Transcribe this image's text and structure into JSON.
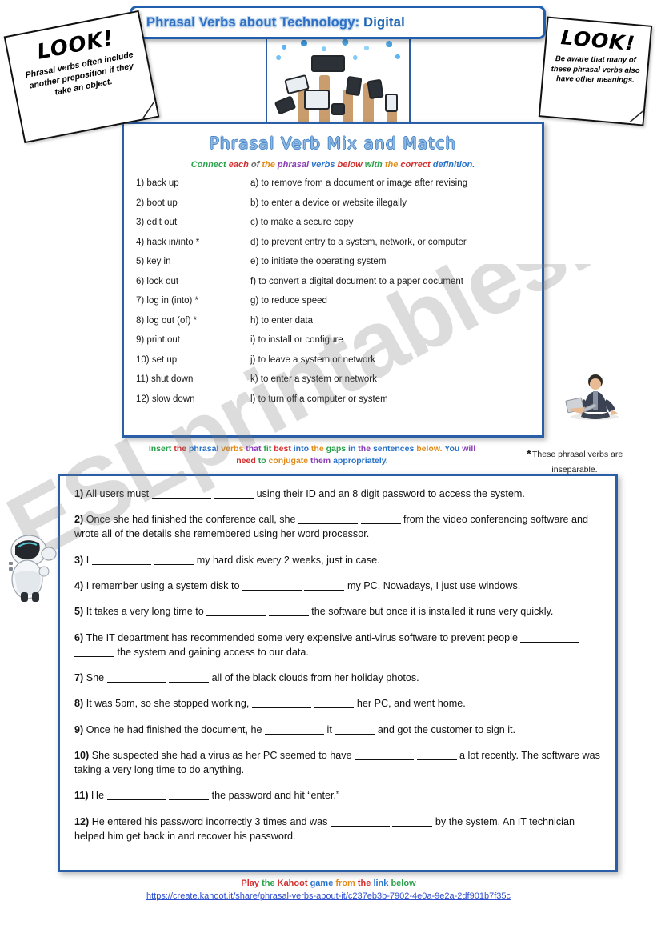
{
  "title": {
    "part1": "Phrasal Verbs about Technology:",
    "part2": " Digital"
  },
  "notes": {
    "left": {
      "heading": "LOOK!",
      "body": "Phrasal verbs often include another preposition if they take an object."
    },
    "right": {
      "heading": "LOOK!",
      "body": "Be aware that many of these phrasal verbs also have other meanings."
    }
  },
  "images": {
    "collage_alt": "technology-devices-collage",
    "man_alt": "man-sitting-with-laptop",
    "robot_alt": "white-robot-peeking"
  },
  "match_section": {
    "heading": "Phrasal Verb Mix and Match",
    "instruction_words": [
      {
        "text": "Connect ",
        "color": "#2aa14b"
      },
      {
        "text": "each ",
        "color": "#d32f2f"
      },
      {
        "text": "of ",
        "color": "#6d6d6d"
      },
      {
        "text": "the ",
        "color": "#e08c1a"
      },
      {
        "text": "phrasal ",
        "color": "#8a3fb5"
      },
      {
        "text": "verbs ",
        "color": "#2a72c9"
      },
      {
        "text": "below ",
        "color": "#d32f2f"
      },
      {
        "text": "with ",
        "color": "#2aa14b"
      },
      {
        "text": "the ",
        "color": "#e08c1a"
      },
      {
        "text": "correct ",
        "color": "#d32f2f"
      },
      {
        "text": "definition.",
        "color": "#2a72c9"
      }
    ],
    "rows": [
      {
        "verb": "1) back up",
        "definition": "a) to remove from a document or image after revising"
      },
      {
        "verb": "2) boot up",
        "definition": "b) to enter a device or website illegally"
      },
      {
        "verb": "3) edit out",
        "definition": "c) to make a secure copy"
      },
      {
        "verb": "4) hack in/into *",
        "definition": "d) to prevent entry to a system, network, or computer"
      },
      {
        "verb": "5) key in",
        "definition": "e) to initiate the operating system"
      },
      {
        "verb": "6) lock out",
        "definition": "f) to convert a digital document to a paper document"
      },
      {
        "verb": "7) log in (into) *",
        "definition": "g) to reduce speed"
      },
      {
        "verb": "8)  log out (of) *",
        "definition": "h) to enter data"
      },
      {
        "verb": "9)  print out",
        "definition": "i) to install or configure"
      },
      {
        "verb": "10) set up",
        "definition": "j) to leave a system or network"
      },
      {
        "verb": "11) shut down",
        "definition": "k) to enter a system  or network"
      },
      {
        "verb": "12) slow down",
        "definition": "l) to turn off a computer or system"
      }
    ]
  },
  "insert_instruction_words": [
    {
      "text": "Insert ",
      "color": "#2aa14b"
    },
    {
      "text": "the ",
      "color": "#d32f2f"
    },
    {
      "text": "phrasal ",
      "color": "#2a72c9"
    },
    {
      "text": "verbs ",
      "color": "#e08c1a"
    },
    {
      "text": "that ",
      "color": "#8a3fb5"
    },
    {
      "text": "fit ",
      "color": "#2aa14b"
    },
    {
      "text": "best ",
      "color": "#d32f2f"
    },
    {
      "text": "into ",
      "color": "#2a72c9"
    },
    {
      "text": "the ",
      "color": "#e08c1a"
    },
    {
      "text": "gaps ",
      "color": "#2aa14b"
    },
    {
      "text": "in ",
      "color": "#2a72c9"
    },
    {
      "text": "the ",
      "color": "#8a3fb5"
    },
    {
      "text": "sentences ",
      "color": "#2a72c9"
    },
    {
      "text": "below. ",
      "color": "#e08c1a"
    },
    {
      "text": "You ",
      "color": "#2a72c9"
    },
    {
      "text": "will ",
      "color": "#8a3fb5"
    },
    {
      "text": "need ",
      "color": "#d32f2f"
    },
    {
      "text": "to ",
      "color": "#2aa14b"
    },
    {
      "text": "conjugate ",
      "color": "#e08c1a"
    },
    {
      "text": "them ",
      "color": "#8a3fb5"
    },
    {
      "text": "appropriately.",
      "color": "#2a72c9"
    }
  ],
  "asterisk_note": "These phrasal verbs are inseparable.",
  "gapfill": [
    {
      "num": "1)",
      "parts": [
        {
          "t": "text",
          "v": " All users must "
        },
        {
          "t": "blank-long"
        },
        {
          "t": "text",
          "v": "  "
        },
        {
          "t": "blank-short"
        },
        {
          "t": "text",
          "v": " using their ID and an 8 digit password to access the system."
        }
      ]
    },
    {
      "num": "2)",
      "parts": [
        {
          "t": "text",
          "v": " Once she had finished the conference call, she "
        },
        {
          "t": "blank-long"
        },
        {
          "t": "text",
          "v": "  "
        },
        {
          "t": "blank-short"
        },
        {
          "t": "text",
          "v": " from the video conferencing software and wrote all of the details she remembered using her word processor."
        }
      ]
    },
    {
      "num": "3)",
      "parts": [
        {
          "t": "text",
          "v": " I "
        },
        {
          "t": "blank-long"
        },
        {
          "t": "text",
          "v": "  "
        },
        {
          "t": "blank-short"
        },
        {
          "t": "text",
          "v": " my hard disk every 2 weeks, just in case."
        }
      ]
    },
    {
      "num": "4)",
      "parts": [
        {
          "t": "text",
          "v": " I remember using a system disk to "
        },
        {
          "t": "blank-long"
        },
        {
          "t": "text",
          "v": "  "
        },
        {
          "t": "blank-short"
        },
        {
          "t": "text",
          "v": " my PC. Nowadays, I just use windows."
        }
      ]
    },
    {
      "num": "5)",
      "parts": [
        {
          "t": "text",
          "v": " It takes a very long time to "
        },
        {
          "t": "blank-long"
        },
        {
          "t": "text",
          "v": "  "
        },
        {
          "t": "blank-short"
        },
        {
          "t": "text",
          "v": " the software but once it is installed it runs very quickly."
        }
      ]
    },
    {
      "num": "6)",
      "parts": [
        {
          "t": "text",
          "v": " The IT department has recommended some very expensive anti-virus software to prevent people "
        },
        {
          "t": "blank-long"
        },
        {
          "t": "text",
          "v": "  "
        },
        {
          "t": "blank-short"
        },
        {
          "t": "text",
          "v": " the system and gaining access to our data."
        }
      ]
    },
    {
      "num": "7)",
      "parts": [
        {
          "t": "text",
          "v": " She "
        },
        {
          "t": "blank-long"
        },
        {
          "t": "text",
          "v": "  "
        },
        {
          "t": "blank-short"
        },
        {
          "t": "text",
          "v": " all of the black clouds from her holiday photos."
        }
      ]
    },
    {
      "num": "8)",
      "parts": [
        {
          "t": "text",
          "v": " It was 5pm, so she stopped working, "
        },
        {
          "t": "blank-long"
        },
        {
          "t": "text",
          "v": "  "
        },
        {
          "t": "blank-short"
        },
        {
          "t": "text",
          "v": " her PC, and went home."
        }
      ]
    },
    {
      "num": "9)",
      "parts": [
        {
          "t": "text",
          "v": " Once he had finished the document, he "
        },
        {
          "t": "blank-long"
        },
        {
          "t": "text",
          "v": " it "
        },
        {
          "t": "blank-short"
        },
        {
          "t": "text",
          "v": " and got the customer to sign it."
        }
      ]
    },
    {
      "num": "10)",
      "parts": [
        {
          "t": "text",
          "v": " She suspected she had a virus as her PC seemed to have "
        },
        {
          "t": "blank-long"
        },
        {
          "t": "text",
          "v": "  "
        },
        {
          "t": "blank-short"
        },
        {
          "t": "text",
          "v": " a lot recently. The software was taking a very long time to do anything."
        }
      ]
    },
    {
      "num": "11)",
      "parts": [
        {
          "t": "text",
          "v": " He "
        },
        {
          "t": "blank-long"
        },
        {
          "t": "text",
          "v": "  "
        },
        {
          "t": "blank-short"
        },
        {
          "t": "text",
          "v": " the password and hit “enter.”"
        }
      ]
    },
    {
      "num": "12)",
      "parts": [
        {
          "t": "text",
          "v": " He entered his password incorrectly 3 times and was "
        },
        {
          "t": "blank-long"
        },
        {
          "t": "text",
          "v": "  "
        },
        {
          "t": "blank-short"
        },
        {
          "t": "text",
          "v": " by the system. An IT technician helped him get back in and recover his password."
        }
      ]
    }
  ],
  "footer": {
    "line1_words": [
      {
        "text": "Play ",
        "color": "#d32f2f"
      },
      {
        "text": "the ",
        "color": "#2aa14b"
      },
      {
        "text": "Kahoot ",
        "color": "#d32f2f"
      },
      {
        "text": "game ",
        "color": "#2a72c9"
      },
      {
        "text": "from ",
        "color": "#e08c1a"
      },
      {
        "text": "the ",
        "color": "#d32f2f"
      },
      {
        "text": "link ",
        "color": "#2a72c9"
      },
      {
        "text": "below",
        "color": "#2aa14b"
      }
    ],
    "link": "https://create.kahoot.it/share/phrasal-verbs-about-it/c237eb3b-7902-4e0a-9e2a-2df901b7f35c"
  },
  "watermark": "ESLprintables.com",
  "colors": {
    "panel_border": "#2a5fa8",
    "title_border": "#1f5fad",
    "link": "#2f4fd0"
  }
}
